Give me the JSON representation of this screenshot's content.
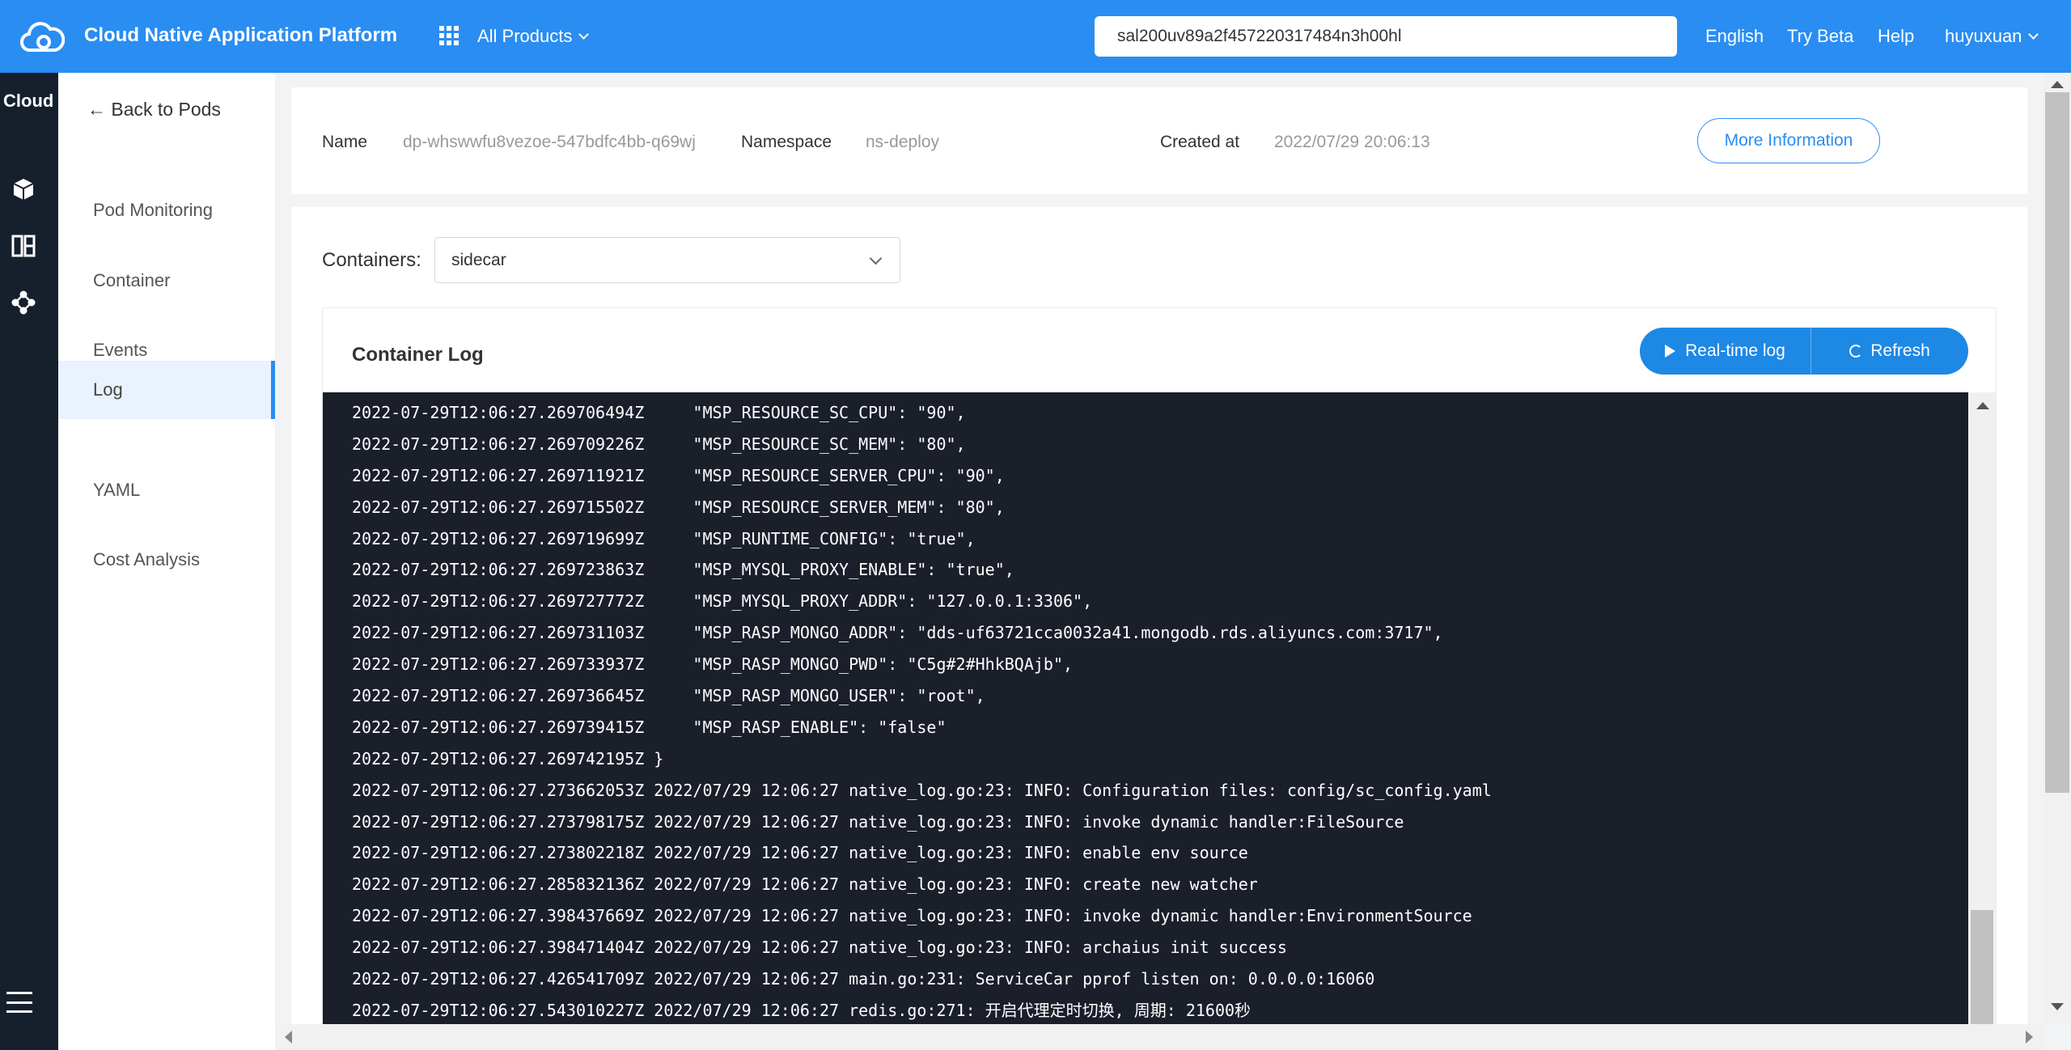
{
  "header": {
    "brand": "Cloud Native Application Platform",
    "products_label": "All Products",
    "search_value": "sal200uv89a2f457220317484n3h00hl",
    "nav": {
      "language": "English",
      "try_beta": "Try Beta",
      "help": "Help",
      "user": "huyuxuan"
    },
    "accent_color": "#2a8df2"
  },
  "rail": {
    "title": "Cloud",
    "icons": [
      "cube-icon",
      "columns-icon",
      "network-icon",
      "menu-icon"
    ]
  },
  "subnav": {
    "back_label": "← Back to Pods",
    "items": [
      {
        "label": "Pod Monitoring"
      },
      {
        "label": "Container"
      },
      {
        "label": "Events"
      },
      {
        "label": "Log"
      },
      {
        "label": "YAML"
      },
      {
        "label": "Cost Analysis"
      }
    ],
    "active_item": "Log"
  },
  "pod_info": {
    "name_label": "Name",
    "name_value": "dp-whswwfu8vezoe-547bdfc4bb-q69wj",
    "namespace_label": "Namespace",
    "namespace_value": "ns-deploy",
    "created_label": "Created at",
    "created_value": "2022/07/29 20:06:13",
    "more_button": "More Information"
  },
  "containers": {
    "label": "Containers:",
    "selected": "sidecar"
  },
  "log": {
    "title": "Container Log",
    "realtime_button": "Real-time log",
    "refresh_button": "Refresh",
    "lines": [
      "2022-07-29T12:06:27.269706494Z     \"MSP_RESOURCE_SC_CPU\": \"90\",",
      "2022-07-29T12:06:27.269709226Z     \"MSP_RESOURCE_SC_MEM\": \"80\",",
      "2022-07-29T12:06:27.269711921Z     \"MSP_RESOURCE_SERVER_CPU\": \"90\",",
      "2022-07-29T12:06:27.269715502Z     \"MSP_RESOURCE_SERVER_MEM\": \"80\",",
      "2022-07-29T12:06:27.269719699Z     \"MSP_RUNTIME_CONFIG\": \"true\",",
      "2022-07-29T12:06:27.269723863Z     \"MSP_MYSQL_PROXY_ENABLE\": \"true\",",
      "2022-07-29T12:06:27.269727772Z     \"MSP_MYSQL_PROXY_ADDR\": \"127.0.0.1:3306\",",
      "2022-07-29T12:06:27.269731103Z     \"MSP_RASP_MONGO_ADDR\": \"dds-uf63721cca0032a41.mongodb.rds.aliyuncs.com:3717\",",
      "2022-07-29T12:06:27.269733937Z     \"MSP_RASP_MONGO_PWD\": \"C5g#2#HhkBQAjb\",",
      "2022-07-29T12:06:27.269736645Z     \"MSP_RASP_MONGO_USER\": \"root\",",
      "2022-07-29T12:06:27.269739415Z     \"MSP_RASP_ENABLE\": \"false\"",
      "2022-07-29T12:06:27.269742195Z }",
      "2022-07-29T12:06:27.273662053Z 2022/07/29 12:06:27 native_log.go:23: INFO: Configuration files: config/sc_config.yaml",
      "2022-07-29T12:06:27.273798175Z 2022/07/29 12:06:27 native_log.go:23: INFO: invoke dynamic handler:FileSource",
      "2022-07-29T12:06:27.273802218Z 2022/07/29 12:06:27 native_log.go:23: INFO: enable env source",
      "2022-07-29T12:06:27.285832136Z 2022/07/29 12:06:27 native_log.go:23: INFO: create new watcher",
      "2022-07-29T12:06:27.398437669Z 2022/07/29 12:06:27 native_log.go:23: INFO: invoke dynamic handler:EnvironmentSource",
      "2022-07-29T12:06:27.398471404Z 2022/07/29 12:06:27 native_log.go:23: INFO: archaius init success",
      "2022-07-29T12:06:27.426541709Z 2022/07/29 12:06:27 main.go:231: ServiceCar pprof listen on: 0.0.0.0:16060",
      "2022-07-29T12:06:27.543010227Z 2022/07/29 12:06:27 redis.go:271: 开启代理定时切换, 周期: 21600秒"
    ]
  }
}
